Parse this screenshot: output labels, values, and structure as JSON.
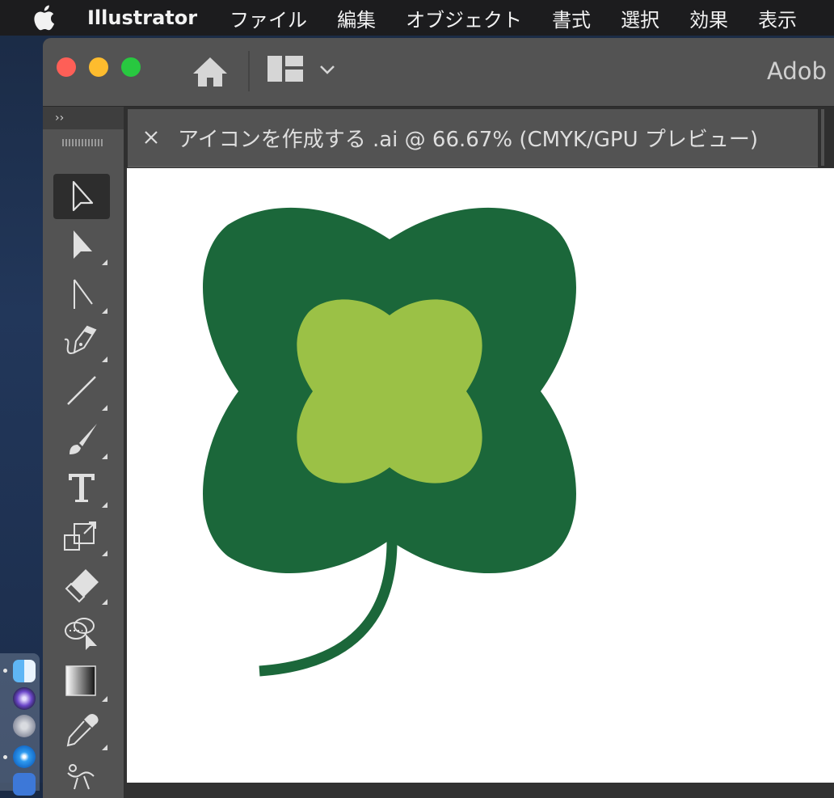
{
  "menubar": {
    "apple_icon": "apple-logo-icon",
    "app_name": "Illustrator",
    "items": [
      "ファイル",
      "編集",
      "オブジェクト",
      "書式",
      "選択",
      "効果",
      "表示"
    ]
  },
  "window": {
    "title_partial": "Adob",
    "workspace_icon": "workspace-switcher-icon"
  },
  "tools_panel": {
    "collapse_label": "››",
    "tools": [
      {
        "name": "selection-tool",
        "icon": "selection-arrow-icon",
        "active": true
      },
      {
        "name": "direct-selection-tool",
        "icon": "direct-selection-arrow-icon"
      },
      {
        "name": "anchor-tool",
        "icon": "anchor-point-icon"
      },
      {
        "name": "pen-tool",
        "icon": "pen-nib-icon"
      },
      {
        "name": "line-tool",
        "icon": "line-segment-icon"
      },
      {
        "name": "paintbrush-tool",
        "icon": "paintbrush-icon"
      },
      {
        "name": "type-tool",
        "icon": "type-t-icon"
      },
      {
        "name": "scale-tool",
        "icon": "scale-icon"
      },
      {
        "name": "eraser-tool",
        "icon": "eraser-icon"
      },
      {
        "name": "shape-builder-tool",
        "icon": "shape-builder-icon"
      },
      {
        "name": "gradient-tool",
        "icon": "gradient-icon"
      },
      {
        "name": "eyedropper-tool",
        "icon": "eyedropper-icon"
      },
      {
        "name": "puppet-warp-tool",
        "icon": "puppet-warp-icon"
      }
    ]
  },
  "document": {
    "tab_title": "アイコンを作成する .ai @ 66.67% (CMYK/GPU プレビュー)",
    "artwork": {
      "outer_color": "#1b673a",
      "inner_color": "#9bc146",
      "stem_color": "#1b673a"
    }
  },
  "dock": {
    "items": [
      "finder-icon",
      "siri-icon",
      "launchpad-icon",
      "safari-icon",
      "preview-icon"
    ]
  }
}
